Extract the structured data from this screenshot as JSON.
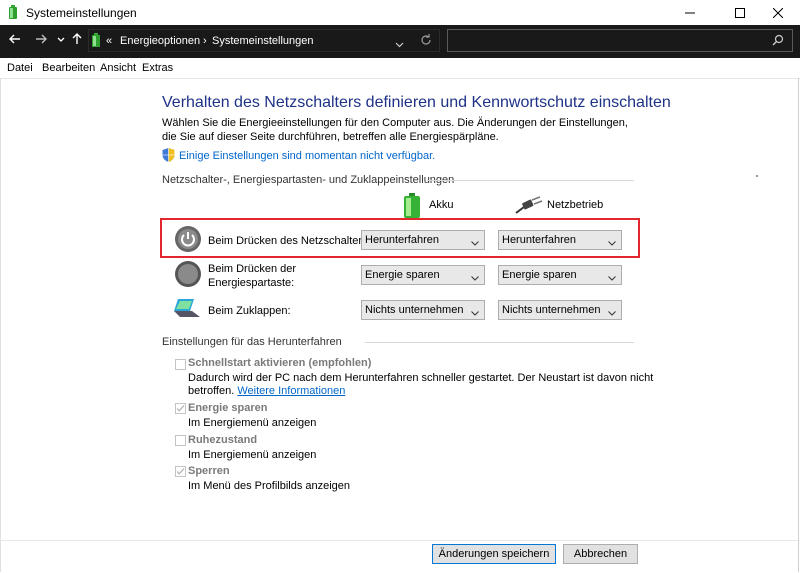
{
  "window": {
    "title": "Systemeinstellungen",
    "controls": {
      "minimize": "minimize-icon",
      "maximize": "maximize-icon",
      "close": "close-icon"
    }
  },
  "nav": {
    "back": "back-arrow-icon",
    "forward": "forward-arrow-icon",
    "recent": "chevron-down-icon",
    "up": "up-arrow-icon",
    "address": {
      "sep": "«",
      "crumbs": [
        "Energieoptionen",
        "Systemeinstellungen"
      ]
    },
    "refresh": "refresh-icon",
    "search_icon": "search-icon"
  },
  "menu": [
    "Datei",
    "Bearbeiten",
    "Ansicht",
    "Extras"
  ],
  "main": {
    "heading": "Verhalten des Netzschalters definieren und Kennwortschutz einschalten",
    "description": "Wählen Sie die Energieeinstellungen für den Computer aus. Die Änderungen der Einstellungen, die Sie auf dieser Seite durchführen, betreffen alle Energiespärpläne.",
    "unavailable_link": "Einige Einstellungen sind momentan nicht verfügbar.",
    "buttons_section": {
      "title": "Netzschalter-, Energiespartasten- und Zuklappeinstellungen",
      "col_battery": "Akku",
      "col_power": "Netzbetrieb",
      "rows": [
        {
          "label": "Beim Drücken des Netzschalters:",
          "battery": "Herunterfahren",
          "power": "Herunterfahren"
        },
        {
          "label": "Beim Drücken der Energiespartaste:",
          "battery": "Energie sparen",
          "power": "Energie sparen"
        },
        {
          "label": "Beim Zuklappen:",
          "battery": "Nichts unternehmen",
          "power": "Nichts unternehmen"
        }
      ]
    },
    "shutdown_section": {
      "title": "Einstellungen für das Herunterfahren",
      "options": [
        {
          "label": "Schnellstart aktivieren (empfohlen)",
          "checked": false,
          "desc": "Dadurch wird der PC nach dem Herunterfahren schneller gestartet. Der Neustart ist davon nicht",
          "desc2": "betroffen.",
          "link": "Weitere Informationen"
        },
        {
          "label": "Energie sparen",
          "checked": true,
          "desc": "Im Energiemenü anzeigen"
        },
        {
          "label": "Ruhezustand",
          "checked": false,
          "desc": "Im Energiemenü anzeigen"
        },
        {
          "label": "Sperren",
          "checked": true,
          "desc": "Im Menü des Profilbilds anzeigen"
        }
      ]
    }
  },
  "footer": {
    "save": "Änderungen speichern",
    "cancel": "Abbrechen"
  }
}
